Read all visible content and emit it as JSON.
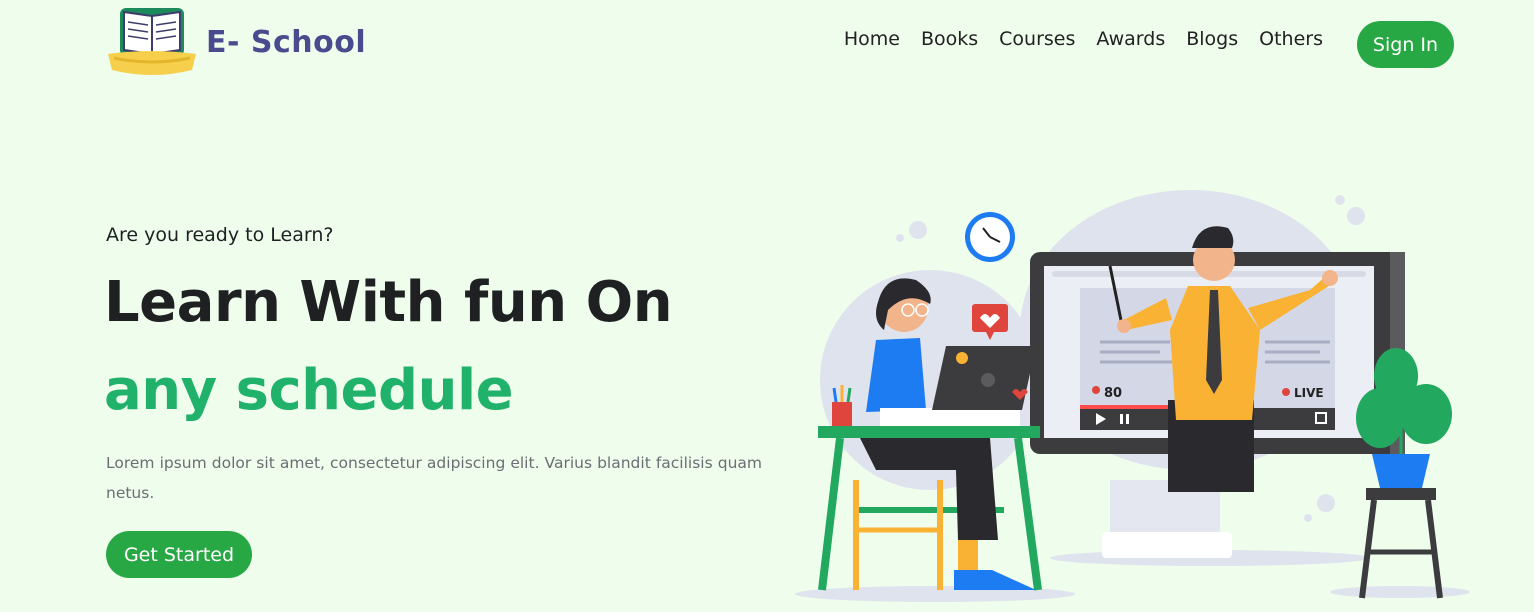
{
  "brand": {
    "name": "E- School"
  },
  "nav": {
    "items": [
      {
        "label": "Home"
      },
      {
        "label": "Books"
      },
      {
        "label": "Courses"
      },
      {
        "label": "Awards"
      },
      {
        "label": "Blogs"
      },
      {
        "label": "Others"
      }
    ],
    "signin_label": "Sign In"
  },
  "hero": {
    "subtitle": "Are you ready to Learn?",
    "title_line1": "Learn With fun On",
    "title_line2": "any schedule",
    "description": "Lorem ipsum dolor sit amet, consectetur adipiscing elit. Varius blandit facilisis quam netus.",
    "cta_label": "Get Started"
  },
  "illustration": {
    "viewer_count": "80",
    "live_label": "LIVE"
  },
  "colors": {
    "background": "#effdec",
    "primary_green": "#28a745",
    "accent_green": "#20b16a",
    "brand_purple": "#4a4b8f",
    "text_dark": "#1e2022"
  }
}
